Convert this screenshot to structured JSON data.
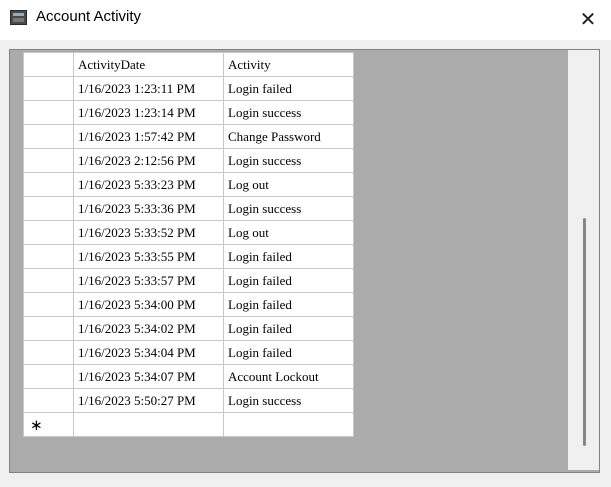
{
  "window": {
    "title": "Account Activity",
    "close_glyph": "✕",
    "app_icon": "app-window-icon"
  },
  "grid": {
    "columns": [
      "ActivityDate",
      "Activity"
    ],
    "rows": [
      [
        "1/16/2023 1:23:11 PM",
        "Login failed"
      ],
      [
        "1/16/2023 1:23:14 PM",
        "Login success"
      ],
      [
        "1/16/2023 1:57:42 PM",
        "Change Password"
      ],
      [
        "1/16/2023 2:12:56 PM",
        "Login success"
      ],
      [
        "1/16/2023 5:33:23 PM",
        "Log out"
      ],
      [
        "1/16/2023 5:33:36 PM",
        "Login success"
      ],
      [
        "1/16/2023 5:33:52 PM",
        "Log out"
      ],
      [
        "1/16/2023 5:33:55 PM",
        "Login failed"
      ],
      [
        "1/16/2023 5:33:57 PM",
        "Login failed"
      ],
      [
        "1/16/2023 5:34:00 PM",
        "Login failed"
      ],
      [
        "1/16/2023 5:34:02 PM",
        "Login failed"
      ],
      [
        "1/16/2023 5:34:04 PM",
        "Login failed"
      ],
      [
        "1/16/2023 5:34:07 PM",
        "Account Lockout"
      ],
      [
        "1/16/2023 5:50:27 PM",
        "Login success"
      ]
    ],
    "new_row_glyph": "∗"
  },
  "colors": {
    "grid_background": "#ababab",
    "cell_border": "#c8c8c8"
  }
}
